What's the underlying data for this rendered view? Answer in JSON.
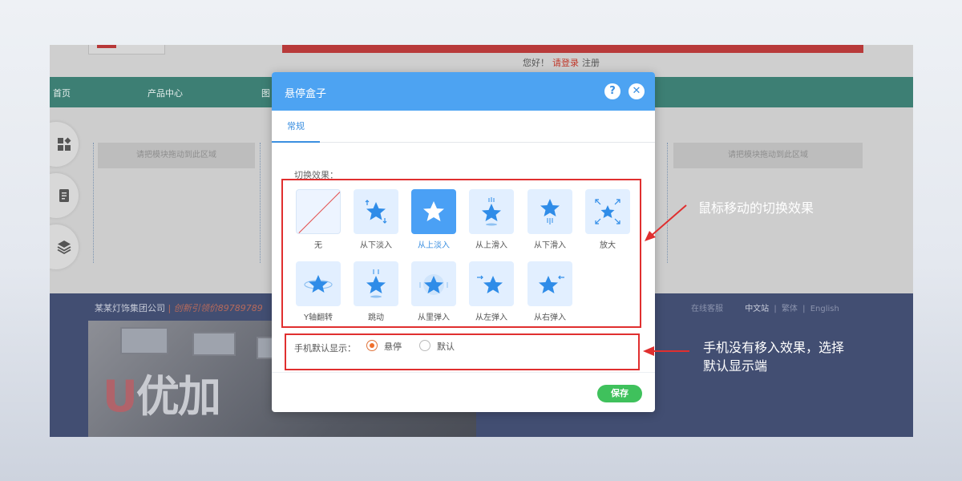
{
  "site": {
    "greeting": "您好！",
    "login": "请登录",
    "register": "注册",
    "nav": [
      "首页",
      "产品中心",
      "图"
    ],
    "drop_hint": "请把模块拖动到此区域",
    "company": "某某灯饰集团公司",
    "slogan": "| 创新引领价89789789",
    "online_service": "在线客服",
    "lang_cn": "中文站",
    "lang_tw": "繁体",
    "lang_en": "English",
    "photo_sign": "优加"
  },
  "dialog": {
    "title": "悬停盒子",
    "help": "?",
    "close": "✕",
    "tab": "常规",
    "section_label": "切换效果：",
    "effects": [
      {
        "label": "无",
        "icon": "none-icon"
      },
      {
        "label": "从下淡入",
        "icon": "fade-up-star-icon"
      },
      {
        "label": "从上淡入",
        "icon": "fade-down-star-icon",
        "selected": true
      },
      {
        "label": "从上滑入",
        "icon": "slide-down-star-icon"
      },
      {
        "label": "从下滑入",
        "icon": "slide-up-star-icon"
      },
      {
        "label": "放大",
        "icon": "zoom-star-icon"
      },
      {
        "label": "Y轴翻转",
        "icon": "flip-star-icon"
      },
      {
        "label": "跳动",
        "icon": "bounce-star-icon"
      },
      {
        "label": "从里弹入",
        "icon": "bounce-in-star-icon"
      },
      {
        "label": "从左弹入",
        "icon": "bounce-left-star-icon"
      },
      {
        "label": "从右弹入",
        "icon": "bounce-right-star-icon"
      }
    ],
    "mobile_label": "手机默认显示：",
    "option_hover": "悬停",
    "option_default": "默认",
    "selected_option": "悬停",
    "save": "保存"
  },
  "annotations": {
    "effects_note": "鼠标移动的切换效果",
    "mobile_note_line1": "手机没有移入效果，选择",
    "mobile_note_line2": "默认显示端"
  },
  "colors": {
    "accent": "#4da3f2",
    "annotation": "#e02f2f",
    "save": "#3fc15c",
    "radio_on": "#f06f2b"
  }
}
